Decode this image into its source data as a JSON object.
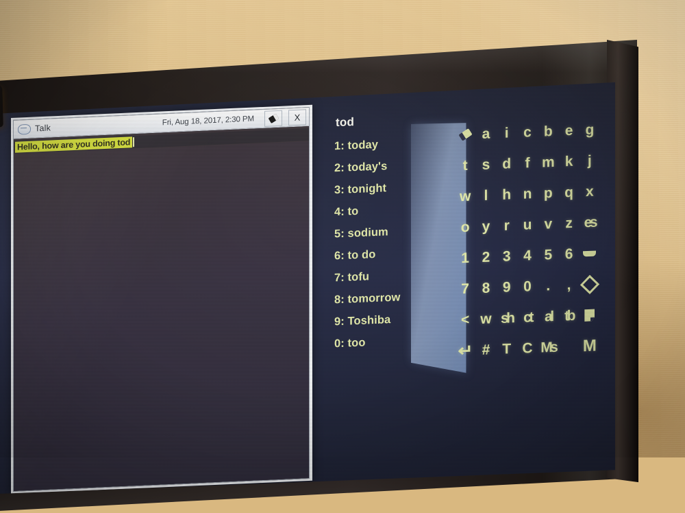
{
  "scene": {
    "device_label": "wall-mounted-aac-eye-gaze-display",
    "wall_color": "#ddbd85",
    "bezel_color": "#1d1815",
    "screen_bg": "#232845"
  },
  "camera": {
    "name": "eye-tracking-camera-module"
  },
  "talk_window": {
    "icon": "talk-window-icon",
    "title": "Talk",
    "datetime": "Fri, Aug 18, 2017, 2:30 PM",
    "erase_button": {
      "icon": "eraser-icon",
      "label": ""
    },
    "close_button": {
      "icon": "close-icon",
      "label": "X"
    },
    "composed_text": "Hello, how are you doing tod",
    "text_highlight_color": "#d8e23a",
    "caret_visible": true
  },
  "aac_panel": {
    "current_word": "tod",
    "predictions": [
      {
        "index": "1",
        "label": "1: today"
      },
      {
        "index": "2",
        "label": "2: today's"
      },
      {
        "index": "3",
        "label": "3: tonight"
      },
      {
        "index": "4",
        "label": "4: to"
      },
      {
        "index": "5",
        "label": "5: sodium"
      },
      {
        "index": "6",
        "label": "6: to do"
      },
      {
        "index": "7",
        "label": "7: tofu"
      },
      {
        "index": "8",
        "label": "8: tomorrow"
      },
      {
        "index": "9",
        "label": "9: Toshiba"
      },
      {
        "index": "0",
        "label": "0: too"
      }
    ],
    "scan_highlight": {
      "name": "scanning-highlight-column",
      "color": "#a8c0e4"
    },
    "key_text_color": "#e9f0ad",
    "keys": [
      {
        "name": "backspace-key",
        "type": "glyph",
        "glyph": "eraser-icon",
        "label": ""
      },
      {
        "name": "key-a",
        "type": "text",
        "label": "a"
      },
      {
        "name": "key-i",
        "type": "text",
        "label": "i"
      },
      {
        "name": "key-c",
        "type": "text",
        "label": "c"
      },
      {
        "name": "key-b",
        "type": "text",
        "label": "b"
      },
      {
        "name": "key-e",
        "type": "text",
        "label": "e"
      },
      {
        "name": "key-g",
        "type": "text",
        "label": "g"
      },
      {
        "name": "key-t",
        "type": "text",
        "label": "t"
      },
      {
        "name": "key-s",
        "type": "text",
        "label": "s"
      },
      {
        "name": "key-d",
        "type": "text",
        "label": "d"
      },
      {
        "name": "key-f",
        "type": "text",
        "label": "f"
      },
      {
        "name": "key-m",
        "type": "text",
        "label": "m"
      },
      {
        "name": "key-k",
        "type": "text",
        "label": "k"
      },
      {
        "name": "key-j",
        "type": "text",
        "label": "j"
      },
      {
        "name": "key-w",
        "type": "text",
        "label": "w"
      },
      {
        "name": "key-l",
        "type": "text",
        "label": "l"
      },
      {
        "name": "key-h",
        "type": "text",
        "label": "h"
      },
      {
        "name": "key-n",
        "type": "text",
        "label": "n"
      },
      {
        "name": "key-p",
        "type": "text",
        "label": "p"
      },
      {
        "name": "key-q",
        "type": "text",
        "label": "q"
      },
      {
        "name": "key-x",
        "type": "text",
        "label": "x"
      },
      {
        "name": "key-o",
        "type": "text",
        "label": "o"
      },
      {
        "name": "key-y",
        "type": "text",
        "label": "y"
      },
      {
        "name": "key-r",
        "type": "text",
        "label": "r"
      },
      {
        "name": "key-u",
        "type": "text",
        "label": "u"
      },
      {
        "name": "key-v",
        "type": "text",
        "label": "v"
      },
      {
        "name": "key-z",
        "type": "text",
        "label": "z"
      },
      {
        "name": "key-es",
        "type": "text",
        "label": "es"
      },
      {
        "name": "key-1",
        "type": "text",
        "label": "1"
      },
      {
        "name": "key-2",
        "type": "text",
        "label": "2"
      },
      {
        "name": "key-3",
        "type": "text",
        "label": "3"
      },
      {
        "name": "key-4",
        "type": "text",
        "label": "4"
      },
      {
        "name": "key-5",
        "type": "text",
        "label": "5"
      },
      {
        "name": "key-6",
        "type": "text",
        "label": "6"
      },
      {
        "name": "space-key",
        "type": "glyph",
        "glyph": "space-icon",
        "label": ""
      },
      {
        "name": "key-7",
        "type": "text",
        "label": "7"
      },
      {
        "name": "key-8",
        "type": "text",
        "label": "8"
      },
      {
        "name": "key-9",
        "type": "text",
        "label": "9"
      },
      {
        "name": "key-0",
        "type": "text",
        "label": "0"
      },
      {
        "name": "key-period",
        "type": "text",
        "label": "."
      },
      {
        "name": "key-comma",
        "type": "text",
        "label": ","
      },
      {
        "name": "diamond-key",
        "type": "glyph",
        "glyph": "diamond-icon",
        "label": ""
      },
      {
        "name": "back-arrow-key",
        "type": "text",
        "label": "<"
      },
      {
        "name": "word-nav-key",
        "type": "text",
        "label": "w"
      },
      {
        "name": "shift-key",
        "type": "text",
        "label": "sh"
      },
      {
        "name": "control-key",
        "type": "text",
        "label": "ct"
      },
      {
        "name": "alt-key",
        "type": "text",
        "label": "al"
      },
      {
        "name": "tab-key",
        "type": "text",
        "label": "tb"
      },
      {
        "name": "page-key",
        "type": "glyph",
        "glyph": "page-icon",
        "label": ""
      },
      {
        "name": "enter-key",
        "type": "glyph",
        "glyph": "enter-icon",
        "label": "↵"
      },
      {
        "name": "key-hash",
        "type": "text",
        "label": "#"
      },
      {
        "name": "key-T",
        "type": "text",
        "label": "T"
      },
      {
        "name": "key-C",
        "type": "text",
        "label": "C"
      },
      {
        "name": "key-Ms",
        "type": "text",
        "label": "Ms"
      },
      {
        "name": "key-blank",
        "type": "text",
        "label": ""
      },
      {
        "name": "key-M",
        "type": "text",
        "label": "M"
      }
    ]
  }
}
